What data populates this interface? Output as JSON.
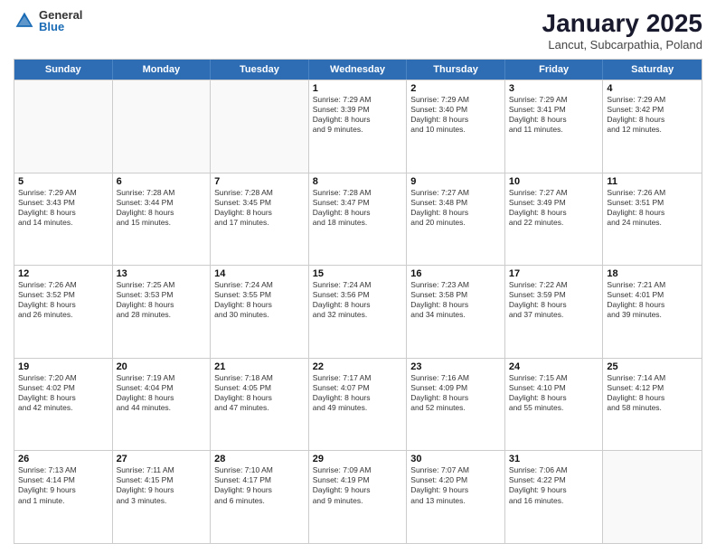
{
  "logo": {
    "general": "General",
    "blue": "Blue"
  },
  "header": {
    "month": "January 2025",
    "location": "Lancut, Subcarpathia, Poland"
  },
  "weekdays": [
    "Sunday",
    "Monday",
    "Tuesday",
    "Wednesday",
    "Thursday",
    "Friday",
    "Saturday"
  ],
  "rows": [
    [
      {
        "day": "",
        "lines": [],
        "empty": true
      },
      {
        "day": "",
        "lines": [],
        "empty": true
      },
      {
        "day": "",
        "lines": [],
        "empty": true
      },
      {
        "day": "1",
        "lines": [
          "Sunrise: 7:29 AM",
          "Sunset: 3:39 PM",
          "Daylight: 8 hours",
          "and 9 minutes."
        ]
      },
      {
        "day": "2",
        "lines": [
          "Sunrise: 7:29 AM",
          "Sunset: 3:40 PM",
          "Daylight: 8 hours",
          "and 10 minutes."
        ]
      },
      {
        "day": "3",
        "lines": [
          "Sunrise: 7:29 AM",
          "Sunset: 3:41 PM",
          "Daylight: 8 hours",
          "and 11 minutes."
        ]
      },
      {
        "day": "4",
        "lines": [
          "Sunrise: 7:29 AM",
          "Sunset: 3:42 PM",
          "Daylight: 8 hours",
          "and 12 minutes."
        ]
      }
    ],
    [
      {
        "day": "5",
        "lines": [
          "Sunrise: 7:29 AM",
          "Sunset: 3:43 PM",
          "Daylight: 8 hours",
          "and 14 minutes."
        ]
      },
      {
        "day": "6",
        "lines": [
          "Sunrise: 7:28 AM",
          "Sunset: 3:44 PM",
          "Daylight: 8 hours",
          "and 15 minutes."
        ]
      },
      {
        "day": "7",
        "lines": [
          "Sunrise: 7:28 AM",
          "Sunset: 3:45 PM",
          "Daylight: 8 hours",
          "and 17 minutes."
        ]
      },
      {
        "day": "8",
        "lines": [
          "Sunrise: 7:28 AM",
          "Sunset: 3:47 PM",
          "Daylight: 8 hours",
          "and 18 minutes."
        ]
      },
      {
        "day": "9",
        "lines": [
          "Sunrise: 7:27 AM",
          "Sunset: 3:48 PM",
          "Daylight: 8 hours",
          "and 20 minutes."
        ]
      },
      {
        "day": "10",
        "lines": [
          "Sunrise: 7:27 AM",
          "Sunset: 3:49 PM",
          "Daylight: 8 hours",
          "and 22 minutes."
        ]
      },
      {
        "day": "11",
        "lines": [
          "Sunrise: 7:26 AM",
          "Sunset: 3:51 PM",
          "Daylight: 8 hours",
          "and 24 minutes."
        ]
      }
    ],
    [
      {
        "day": "12",
        "lines": [
          "Sunrise: 7:26 AM",
          "Sunset: 3:52 PM",
          "Daylight: 8 hours",
          "and 26 minutes."
        ]
      },
      {
        "day": "13",
        "lines": [
          "Sunrise: 7:25 AM",
          "Sunset: 3:53 PM",
          "Daylight: 8 hours",
          "and 28 minutes."
        ]
      },
      {
        "day": "14",
        "lines": [
          "Sunrise: 7:24 AM",
          "Sunset: 3:55 PM",
          "Daylight: 8 hours",
          "and 30 minutes."
        ]
      },
      {
        "day": "15",
        "lines": [
          "Sunrise: 7:24 AM",
          "Sunset: 3:56 PM",
          "Daylight: 8 hours",
          "and 32 minutes."
        ]
      },
      {
        "day": "16",
        "lines": [
          "Sunrise: 7:23 AM",
          "Sunset: 3:58 PM",
          "Daylight: 8 hours",
          "and 34 minutes."
        ]
      },
      {
        "day": "17",
        "lines": [
          "Sunrise: 7:22 AM",
          "Sunset: 3:59 PM",
          "Daylight: 8 hours",
          "and 37 minutes."
        ]
      },
      {
        "day": "18",
        "lines": [
          "Sunrise: 7:21 AM",
          "Sunset: 4:01 PM",
          "Daylight: 8 hours",
          "and 39 minutes."
        ]
      }
    ],
    [
      {
        "day": "19",
        "lines": [
          "Sunrise: 7:20 AM",
          "Sunset: 4:02 PM",
          "Daylight: 8 hours",
          "and 42 minutes."
        ]
      },
      {
        "day": "20",
        "lines": [
          "Sunrise: 7:19 AM",
          "Sunset: 4:04 PM",
          "Daylight: 8 hours",
          "and 44 minutes."
        ]
      },
      {
        "day": "21",
        "lines": [
          "Sunrise: 7:18 AM",
          "Sunset: 4:05 PM",
          "Daylight: 8 hours",
          "and 47 minutes."
        ]
      },
      {
        "day": "22",
        "lines": [
          "Sunrise: 7:17 AM",
          "Sunset: 4:07 PM",
          "Daylight: 8 hours",
          "and 49 minutes."
        ]
      },
      {
        "day": "23",
        "lines": [
          "Sunrise: 7:16 AM",
          "Sunset: 4:09 PM",
          "Daylight: 8 hours",
          "and 52 minutes."
        ]
      },
      {
        "day": "24",
        "lines": [
          "Sunrise: 7:15 AM",
          "Sunset: 4:10 PM",
          "Daylight: 8 hours",
          "and 55 minutes."
        ]
      },
      {
        "day": "25",
        "lines": [
          "Sunrise: 7:14 AM",
          "Sunset: 4:12 PM",
          "Daylight: 8 hours",
          "and 58 minutes."
        ]
      }
    ],
    [
      {
        "day": "26",
        "lines": [
          "Sunrise: 7:13 AM",
          "Sunset: 4:14 PM",
          "Daylight: 9 hours",
          "and 1 minute."
        ]
      },
      {
        "day": "27",
        "lines": [
          "Sunrise: 7:11 AM",
          "Sunset: 4:15 PM",
          "Daylight: 9 hours",
          "and 3 minutes."
        ]
      },
      {
        "day": "28",
        "lines": [
          "Sunrise: 7:10 AM",
          "Sunset: 4:17 PM",
          "Daylight: 9 hours",
          "and 6 minutes."
        ]
      },
      {
        "day": "29",
        "lines": [
          "Sunrise: 7:09 AM",
          "Sunset: 4:19 PM",
          "Daylight: 9 hours",
          "and 9 minutes."
        ]
      },
      {
        "day": "30",
        "lines": [
          "Sunrise: 7:07 AM",
          "Sunset: 4:20 PM",
          "Daylight: 9 hours",
          "and 13 minutes."
        ]
      },
      {
        "day": "31",
        "lines": [
          "Sunrise: 7:06 AM",
          "Sunset: 4:22 PM",
          "Daylight: 9 hours",
          "and 16 minutes."
        ]
      },
      {
        "day": "",
        "lines": [],
        "empty": true
      }
    ]
  ]
}
